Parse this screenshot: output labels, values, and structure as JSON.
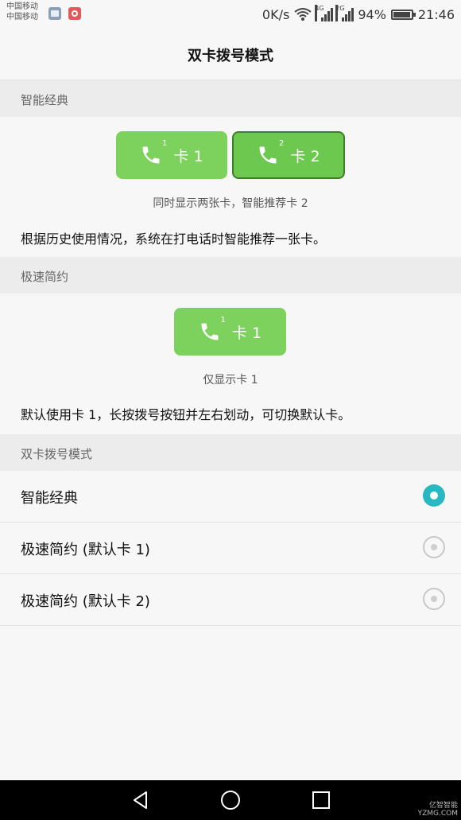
{
  "status_bar": {
    "carrier_1": "中国移动",
    "carrier_2": "中国移动",
    "speed": "0K/s",
    "net_1": "4G",
    "net_2": "2G",
    "battery": "94%",
    "battery_level": 0.94,
    "time": "21:46"
  },
  "header": {
    "title": "双卡拨号模式"
  },
  "smart_section": {
    "header": "智能经典",
    "card1_label": "卡 1",
    "card1_sup": "1",
    "card2_label": "卡 2",
    "card2_sup": "2",
    "caption": "同时显示两张卡，智能推荐卡 2",
    "description": "根据历史使用情况，系统在打电话时智能推荐一张卡。"
  },
  "fast_section": {
    "header": "极速简约",
    "card1_label": "卡 1",
    "card1_sup": "1",
    "caption": "仅显示卡 1",
    "description": "默认使用卡 1，长按拨号按钮并左右划动，可切换默认卡。"
  },
  "mode_section": {
    "header": "双卡拨号模式",
    "options": [
      {
        "label": "智能经典",
        "selected": true
      },
      {
        "label": "极速简约 (默认卡 1)",
        "selected": false
      },
      {
        "label": "极速简约 (默认卡 2)",
        "selected": false
      }
    ]
  },
  "watermark": {
    "line1": "亿智智能",
    "line2": "YZMG.COM"
  },
  "colors": {
    "green": "#7cd25c",
    "radio_on": "#27b8c1"
  }
}
